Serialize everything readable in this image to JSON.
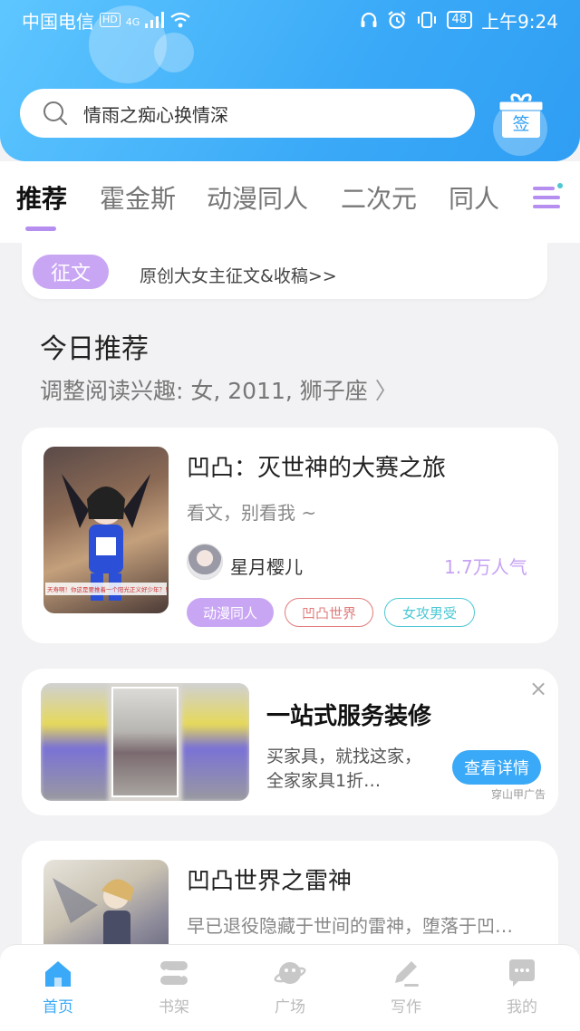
{
  "status_bar": {
    "carrier": "中国电信",
    "hd": "HD",
    "network": "4G",
    "battery": "48",
    "time": "上午9:24"
  },
  "search": {
    "placeholder": "情雨之痴心换情深"
  },
  "gift": {
    "label": "签"
  },
  "tabs": [
    {
      "label": "推荐",
      "active": true
    },
    {
      "label": "霍金斯"
    },
    {
      "label": "动漫同人"
    },
    {
      "label": "二次元"
    },
    {
      "label": "同人"
    }
  ],
  "notice": {
    "badge": "征文",
    "text": "原创大女主征文&收稿>>"
  },
  "today": {
    "title": "今日推荐",
    "subtitle": "调整阅读兴趣: 女, 2011, 狮子座",
    "chevron": "〉"
  },
  "books": [
    {
      "title": "凹凸：灭世神的大赛之旅",
      "desc": "看文，别看我 ~",
      "author": "星月樱儿",
      "popularity": "1.7万人气",
      "cover_caption": "天寿啊！你这是要推着一个阳光正义好少年？！",
      "tags": [
        "动漫同人",
        "凹凸世界",
        "女攻男受"
      ]
    },
    {
      "title": "凹凸世界之雷神",
      "desc": "早已退役隐藏于世间的雷神，堕落于凹…"
    }
  ],
  "ad": {
    "title": "一站式服务装修",
    "desc": "买家具，就找这家，全家家具1折…",
    "button": "查看详情",
    "source": "穿山甲广告",
    "close": "×"
  },
  "bottom_nav": [
    {
      "label": "首页",
      "active": true
    },
    {
      "label": "书架"
    },
    {
      "label": "广场"
    },
    {
      "label": "写作"
    },
    {
      "label": "我的"
    }
  ],
  "colors": {
    "accent_blue": "#3aa9f7",
    "accent_purple": "#c6a2f2",
    "tag_purple": "#c9a6f4",
    "tag_red": "#e07b7b",
    "tag_cyan": "#4cc8d4"
  }
}
